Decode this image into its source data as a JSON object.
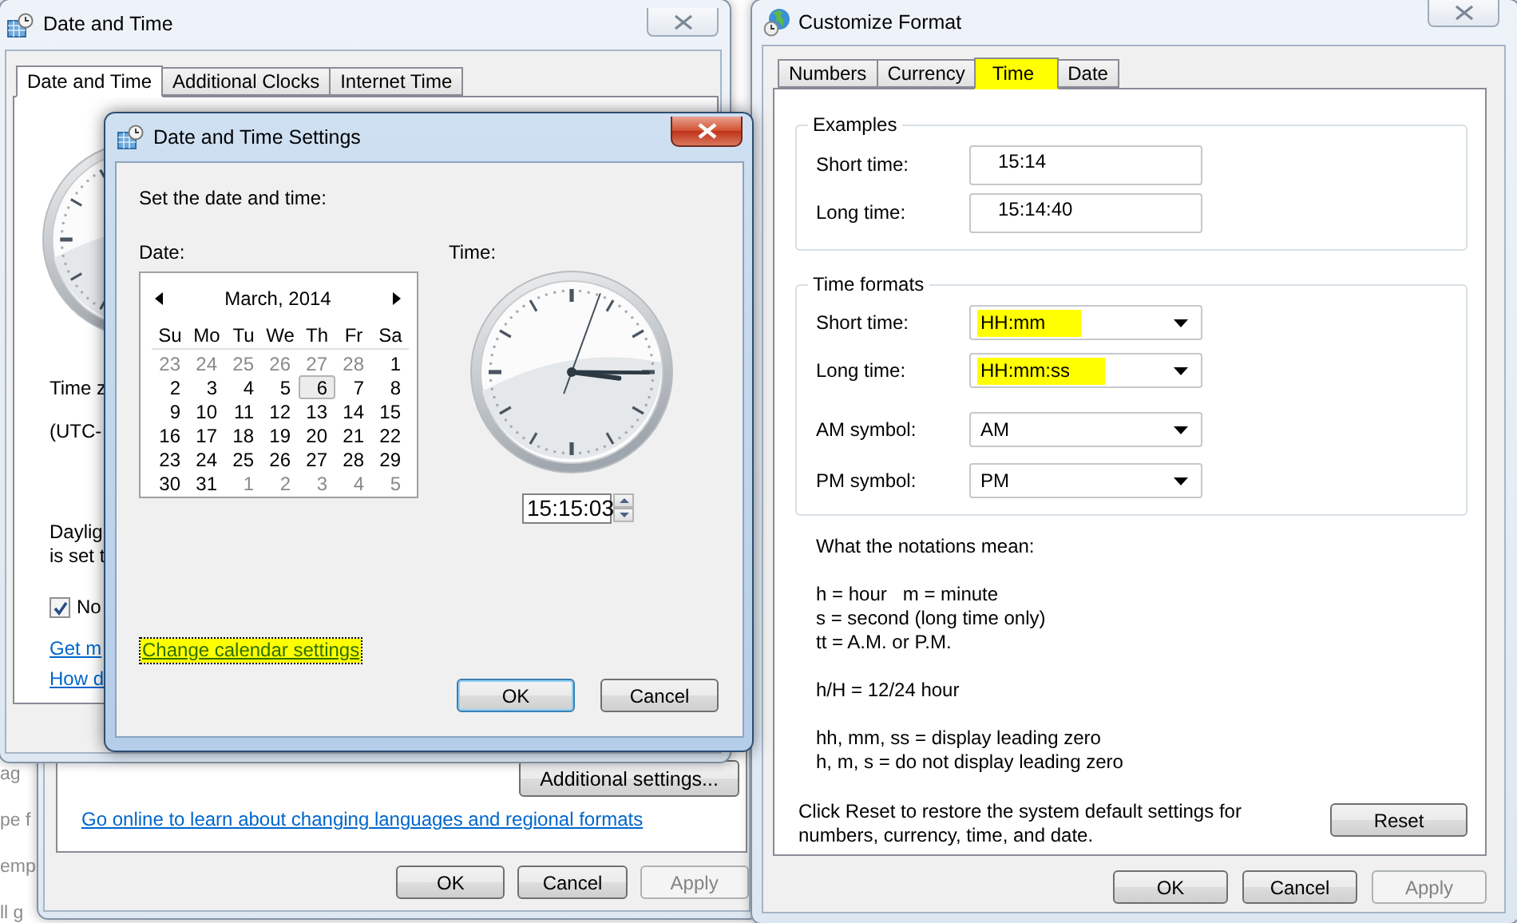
{
  "desktop_fragments": [
    {
      "text": "ag"
    },
    {
      "text": "pe f"
    },
    {
      "text": "emp"
    },
    {
      "text": "ll g"
    }
  ],
  "region_window": {
    "additional_settings": "Additional settings...",
    "online_link": "Go online to learn about changing languages and regional formats",
    "buttons": [
      {
        "label": "OK",
        "disabled": false
      },
      {
        "label": "Cancel",
        "disabled": false
      },
      {
        "label": "Apply",
        "disabled": true
      }
    ]
  },
  "date_time_window": {
    "title": "Date and Time",
    "tabs": [
      {
        "label": "Date and Time",
        "selected": true
      },
      {
        "label": "Additional Clocks",
        "selected": false
      },
      {
        "label": "Internet Time",
        "selected": false
      }
    ],
    "time_zone_label": "Time z",
    "time_zone": "(UTC-",
    "daylight_lines": [
      "Daylig",
      "is set t"
    ],
    "notify_checkbox": {
      "label": "No",
      "checked": true
    },
    "links": [
      "Get m",
      "How d"
    ]
  },
  "settings_dialog": {
    "title": "Date and Time Settings",
    "instruction": "Set the date and time:",
    "date_label": "Date:",
    "time_label": "Time:",
    "calendar": {
      "month": "March, 2014",
      "weekdays": [
        "Su",
        "Mo",
        "Tu",
        "We",
        "Th",
        "Fr",
        "Sa"
      ],
      "weeks": [
        [
          {
            "day": "23",
            "other_month": true,
            "selected": false
          },
          {
            "day": "24",
            "other_month": true,
            "selected": false
          },
          {
            "day": "25",
            "other_month": true,
            "selected": false
          },
          {
            "day": "26",
            "other_month": true,
            "selected": false
          },
          {
            "day": "27",
            "other_month": true,
            "selected": false
          },
          {
            "day": "28",
            "other_month": true,
            "selected": false
          },
          {
            "day": "1",
            "other_month": false,
            "selected": false
          }
        ],
        [
          {
            "day": "2",
            "other_month": false,
            "selected": false
          },
          {
            "day": "3",
            "other_month": false,
            "selected": false
          },
          {
            "day": "4",
            "other_month": false,
            "selected": false
          },
          {
            "day": "5",
            "other_month": false,
            "selected": false
          },
          {
            "day": "6",
            "other_month": false,
            "selected": true
          },
          {
            "day": "7",
            "other_month": false,
            "selected": false
          },
          {
            "day": "8",
            "other_month": false,
            "selected": false
          }
        ],
        [
          {
            "day": "9",
            "other_month": false,
            "selected": false
          },
          {
            "day": "10",
            "other_month": false,
            "selected": false
          },
          {
            "day": "11",
            "other_month": false,
            "selected": false
          },
          {
            "day": "12",
            "other_month": false,
            "selected": false
          },
          {
            "day": "13",
            "other_month": false,
            "selected": false
          },
          {
            "day": "14",
            "other_month": false,
            "selected": false
          },
          {
            "day": "15",
            "other_month": false,
            "selected": false
          }
        ],
        [
          {
            "day": "16",
            "other_month": false,
            "selected": false
          },
          {
            "day": "17",
            "other_month": false,
            "selected": false
          },
          {
            "day": "18",
            "other_month": false,
            "selected": false
          },
          {
            "day": "19",
            "other_month": false,
            "selected": false
          },
          {
            "day": "20",
            "other_month": false,
            "selected": false
          },
          {
            "day": "21",
            "other_month": false,
            "selected": false
          },
          {
            "day": "22",
            "other_month": false,
            "selected": false
          }
        ],
        [
          {
            "day": "23",
            "other_month": false,
            "selected": false
          },
          {
            "day": "24",
            "other_month": false,
            "selected": false
          },
          {
            "day": "25",
            "other_month": false,
            "selected": false
          },
          {
            "day": "26",
            "other_month": false,
            "selected": false
          },
          {
            "day": "27",
            "other_month": false,
            "selected": false
          },
          {
            "day": "28",
            "other_month": false,
            "selected": false
          },
          {
            "day": "29",
            "other_month": false,
            "selected": false
          }
        ],
        [
          {
            "day": "30",
            "other_month": false,
            "selected": false
          },
          {
            "day": "31",
            "other_month": false,
            "selected": false
          },
          {
            "day": "1",
            "other_month": true,
            "selected": false
          },
          {
            "day": "2",
            "other_month": true,
            "selected": false
          },
          {
            "day": "3",
            "other_month": true,
            "selected": false
          },
          {
            "day": "4",
            "other_month": true,
            "selected": false
          },
          {
            "day": "5",
            "other_month": true,
            "selected": false
          }
        ]
      ]
    },
    "time_value": "15:15:03",
    "calendar_link": {
      "label": "Change calendar settings",
      "highlighted": true
    },
    "buttons": [
      {
        "label": "OK",
        "default": true
      },
      {
        "label": "Cancel",
        "default": false
      }
    ]
  },
  "customize_window": {
    "title": "Customize Format",
    "tabs": [
      {
        "label": "Numbers",
        "selected": false,
        "highlighted": false
      },
      {
        "label": "Currency",
        "selected": false,
        "highlighted": false
      },
      {
        "label": "Time",
        "selected": true,
        "highlighted": true
      },
      {
        "label": "Date",
        "selected": false,
        "highlighted": false
      }
    ],
    "examples": {
      "legend": "Examples",
      "rows": [
        {
          "label": "Short time:",
          "value": "15:14"
        },
        {
          "label": "Long time:",
          "value": "15:14:40"
        }
      ]
    },
    "time_formats": {
      "legend": "Time formats",
      "rows": [
        {
          "label": "Short time:",
          "value": "HH:mm",
          "highlighted": true
        },
        {
          "label": "Long time:",
          "value": "HH:mm:ss",
          "highlighted": true
        },
        {
          "label": "AM symbol:",
          "value": "AM",
          "highlighted": false
        },
        {
          "label": "PM symbol:",
          "value": "PM",
          "highlighted": false
        }
      ]
    },
    "notations": [
      [
        "What the notations mean:"
      ],
      [
        "h = hour   m = minute",
        "s = second (long time only)",
        "tt = A.M. or P.M."
      ],
      [
        "h/H = 12/24 hour"
      ],
      [
        "hh, mm, ss = display leading zero",
        "h, m, s = do not display leading zero"
      ]
    ],
    "reset_text": "Click Reset to restore the system default settings for numbers, currency, time, and date.",
    "reset_button": "Reset",
    "buttons": [
      {
        "label": "OK",
        "disabled": false
      },
      {
        "label": "Cancel",
        "disabled": false
      },
      {
        "label": "Apply",
        "disabled": true
      }
    ]
  }
}
